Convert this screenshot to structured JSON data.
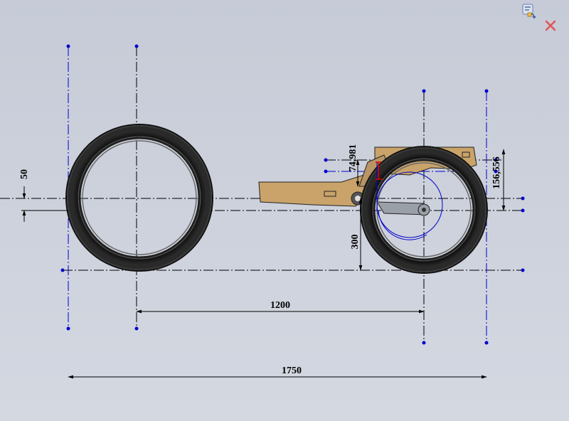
{
  "toolbar": {
    "exit_icon": "sketch-exit-icon",
    "close_icon": "close-icon",
    "close_color": "#e05555"
  },
  "dimensions": {
    "wheelbase": "1200",
    "overall_length": "1750",
    "rear_height_offset": "50",
    "swingarm_height": "300",
    "pivot_offset": "74,981",
    "shock_offset": "156,556"
  },
  "colors": {
    "background": "#c9ced9",
    "tire": "#161616",
    "frame": "#c9a36a",
    "construction_line": "#0000cc",
    "dimension_line": "#000000",
    "highlight": "#e00000"
  }
}
